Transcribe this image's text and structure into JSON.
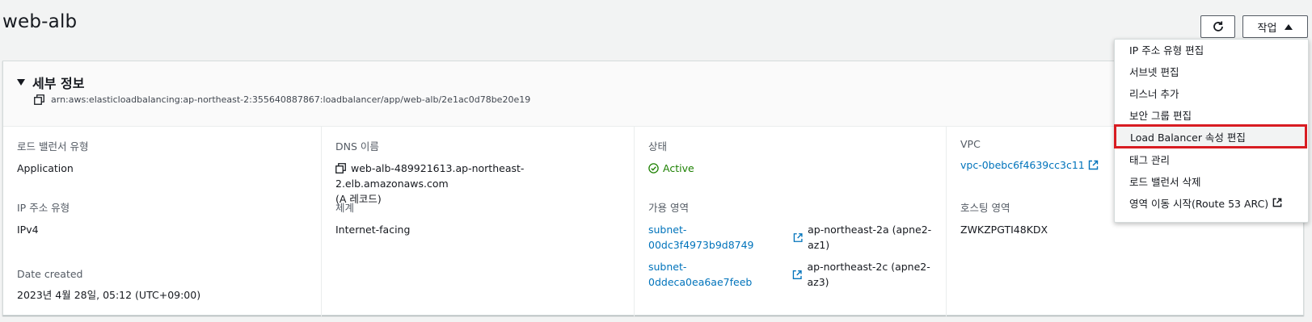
{
  "header": {
    "title": "web-alb",
    "action_label": "작업"
  },
  "details": {
    "section_title": "세부 정보",
    "arn": "arn:aws:elasticloadbalancing:ap-northeast-2:355640887867:loadbalancer/app/web-alb/2e1ac0d78be20e19",
    "fields": {
      "lb_type_label": "로드 밸런서 유형",
      "lb_type_value": "Application",
      "dns_label": "DNS 이름",
      "dns_value": "web-alb-489921613.ap-northeast-2.elb.amazonaws.com",
      "dns_note": "(A 레코드)",
      "state_label": "상태",
      "state_value": "Active",
      "vpc_label": "VPC",
      "vpc_value": "vpc-0bebc6f4639cc3c11",
      "ip_type_label": "IP 주소 유형",
      "ip_type_value": "IPv4",
      "scheme_label": "체계",
      "scheme_value": "Internet-facing",
      "az_label": "가용 영역",
      "subnets": [
        {
          "id": "subnet-00dc3f4973b9d8749",
          "zone": "ap-northeast-2a (apne2-az1)"
        },
        {
          "id": "subnet-0ddeca0ea6ae7feeb",
          "zone": "ap-northeast-2c (apne2-az3)"
        }
      ],
      "hosted_zone_label": "호스팅 영역",
      "hosted_zone_value": "ZWKZPGTI48KDX",
      "date_created_label": "Date created",
      "date_created_value": "2023년 4월 28일, 05:12 (UTC+09:00)"
    }
  },
  "menu": {
    "items": [
      {
        "label": "IP 주소 유형 편집"
      },
      {
        "label": "서브넷 편집"
      },
      {
        "label": "리스너 추가"
      },
      {
        "label": "보안 그룹 편집"
      },
      {
        "label": "Load Balancer 속성 편집"
      },
      {
        "label": "태그 관리"
      },
      {
        "label": "로드 밸런서 삭제"
      },
      {
        "label": "영역 이동 시작(Route 53 ARC)"
      }
    ]
  },
  "colors": {
    "link": "#0073bb",
    "active": "#1d8102",
    "highlight_border": "#d81c22"
  }
}
